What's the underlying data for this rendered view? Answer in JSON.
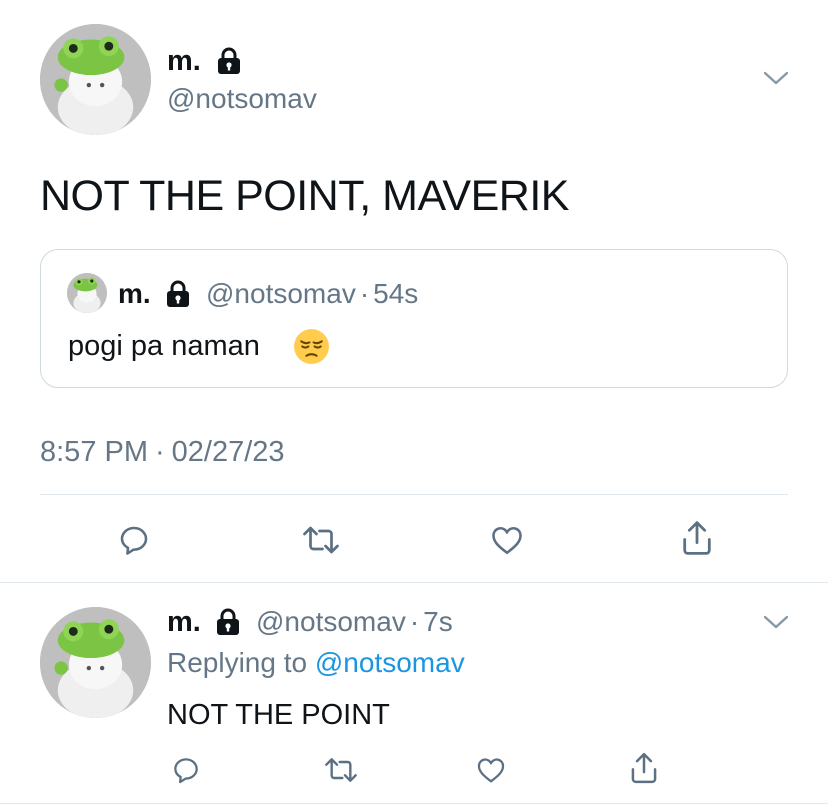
{
  "main_tweet": {
    "display_name": "m.",
    "handle": "@notsomav",
    "text": "NOT THE POINT, MAVERIK",
    "timestamp": "8:57 PM",
    "date_separator": "·",
    "date": "02/27/23",
    "icons": {
      "locked": "lock-icon",
      "menu": "chevron-down-icon"
    }
  },
  "quoted_tweet": {
    "display_name": "m.",
    "handle": "@notsomav",
    "separator": "·",
    "time": "54s",
    "text": "pogi pa naman",
    "emoji": "pensive-face-emoji"
  },
  "actions": [
    "reply-icon",
    "retweet-icon",
    "like-icon",
    "share-icon"
  ],
  "reply_tweet": {
    "display_name": "m.",
    "handle": "@notsomav",
    "separator": "·",
    "time": "7s",
    "replying_to_label": "Replying to",
    "replying_to_handle": "@notsomav",
    "text": "NOT THE POINT"
  },
  "colors": {
    "text": "#0f1419",
    "muted": "#657786",
    "link": "#1b95e0",
    "divider": "#e1e8ed",
    "icon": "#5b7083",
    "avatar_green": "#7cc443"
  }
}
